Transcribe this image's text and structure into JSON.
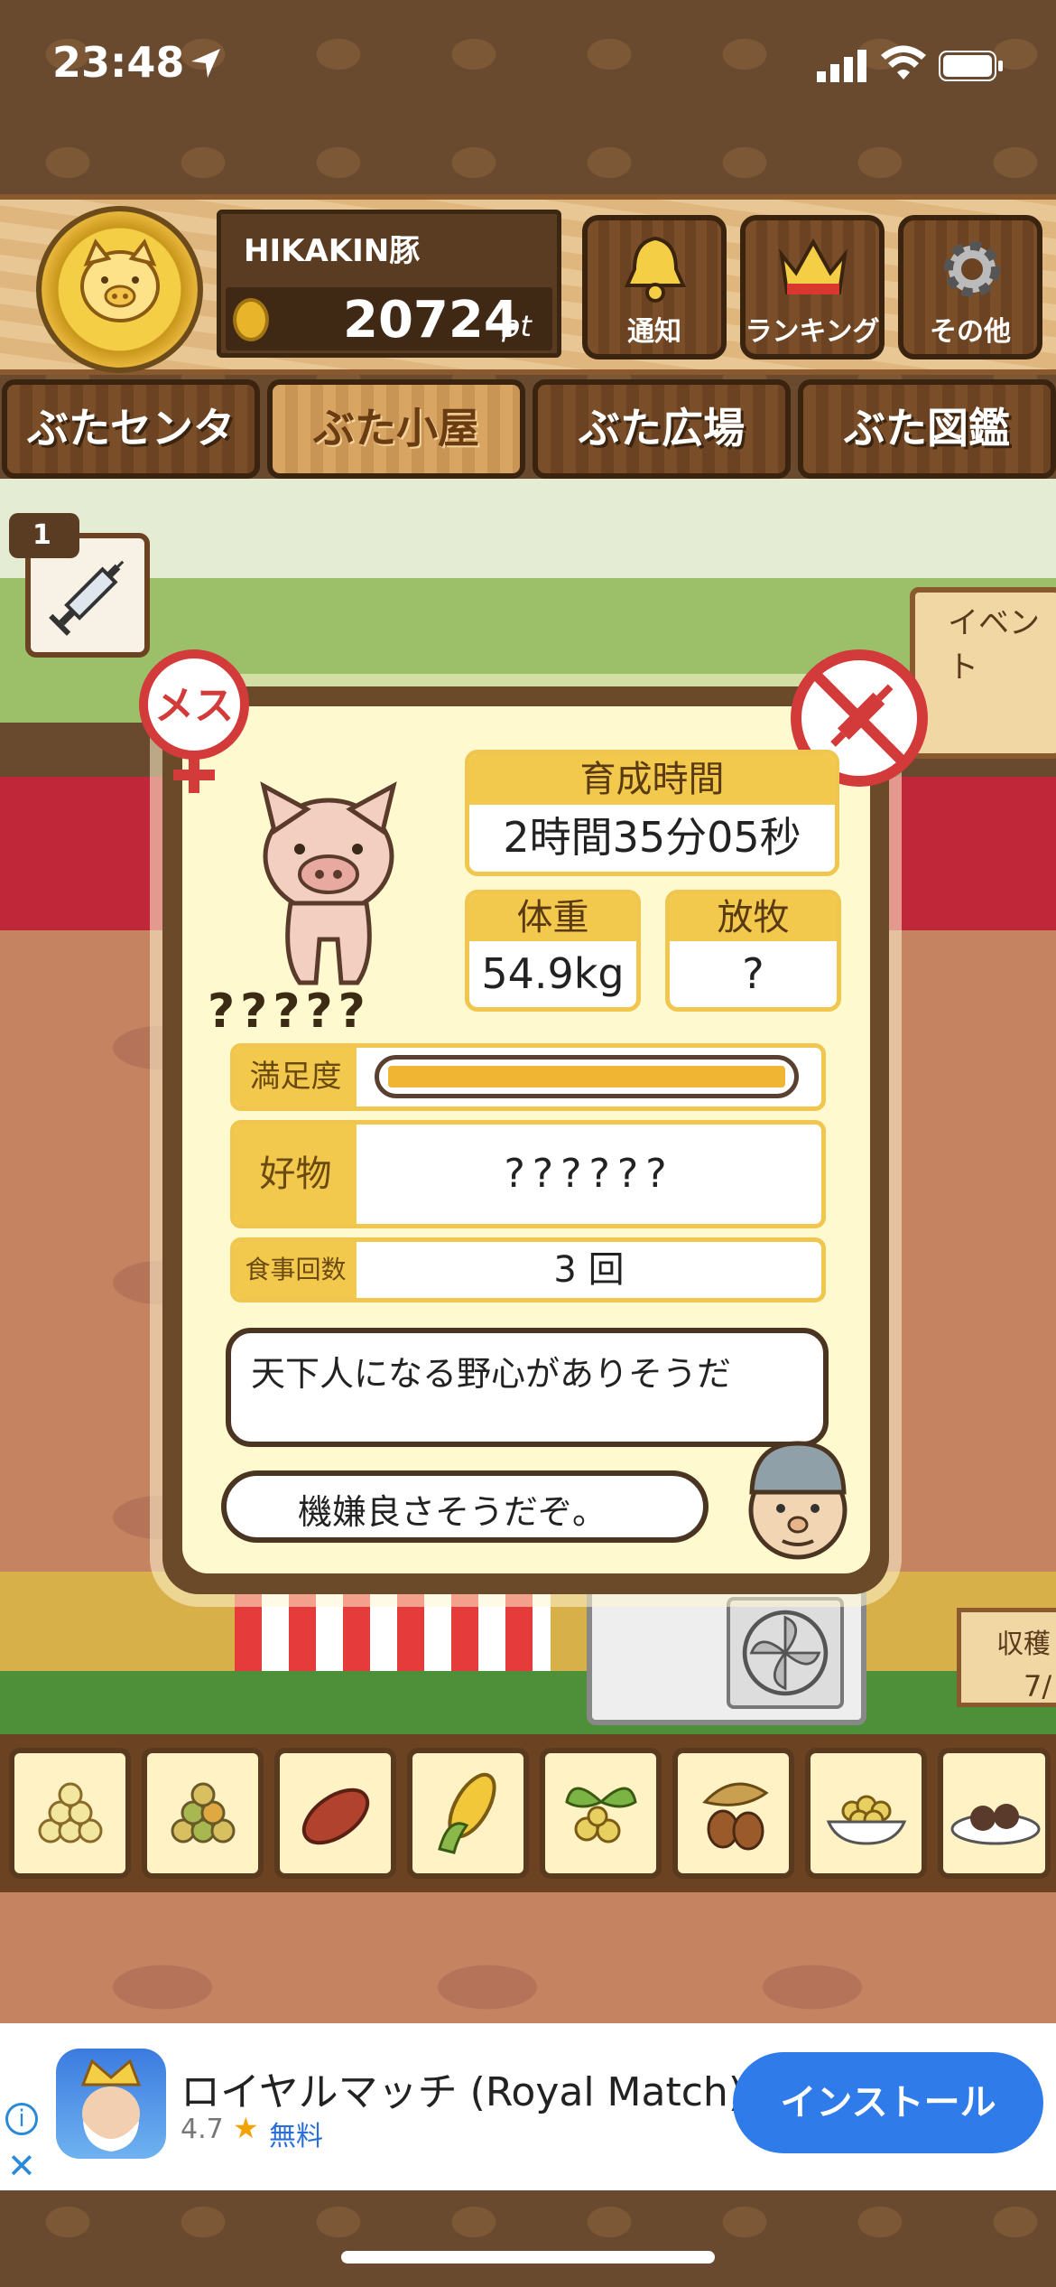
{
  "status": {
    "time": "23:48"
  },
  "player": {
    "name": "HIKAKIN豚",
    "points": "20724",
    "points_unit": "pt"
  },
  "header_buttons": [
    {
      "label": "通知",
      "icon": "bell-icon"
    },
    {
      "label": "ランキング",
      "icon": "crown-icon"
    },
    {
      "label": "その他",
      "icon": "gear-icon"
    }
  ],
  "tabs": [
    {
      "label": "ぶたセンター"
    },
    {
      "label": "ぶた小屋"
    },
    {
      "label": "ぶた広場"
    },
    {
      "label": "ぶた図鑑"
    }
  ],
  "active_tab": "ぶた小屋",
  "items": {
    "syringe_count": "1"
  },
  "scene": {
    "event_sign": "イベント",
    "harvest_sign": "収穫",
    "harvest_count": "7/"
  },
  "popup": {
    "sex_label": "メス",
    "pig_name": "?????",
    "growth_time": {
      "label": "育成時間",
      "value": "2時間35分05秒"
    },
    "weight": {
      "label": "体重",
      "value": "54.9kg"
    },
    "grazing": {
      "label": "放牧",
      "value": "?"
    },
    "satisfaction": {
      "label": "満足度",
      "level": 1.0
    },
    "favorite": {
      "label": "好物",
      "value": "??????"
    },
    "meals": {
      "label": "食事回数",
      "value": "3 回"
    },
    "comment1": "天下人になる野心がありそうだ",
    "comment2": "機嫌良さそうだぞ。"
  },
  "food_items": [
    "grain-icon",
    "mixed-grain-icon",
    "sweet-potato-icon",
    "corn-icon",
    "beans-icon",
    "acorn-icon",
    "soybean-bowl-icon",
    "meatball-plate-icon"
  ],
  "ad": {
    "title": "ロイヤルマッチ (Royal Match)",
    "rating": "4.7",
    "price": "無料",
    "install": "インストール"
  },
  "colors": {
    "accent_yellow": "#f3c94d",
    "ad_button": "#2f7bea"
  }
}
